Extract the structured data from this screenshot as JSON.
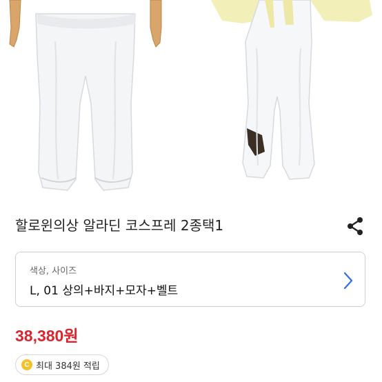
{
  "product": {
    "title": "할로윈의상 알라딘 코스프레 2종택1"
  },
  "option": {
    "label": "색상, 사이즈",
    "value": "L, 01 상의+바지+모자+벨트"
  },
  "price": {
    "amount": "38,380원"
  },
  "points": {
    "coin_symbol": "C",
    "text": "최대 384원 적립"
  },
  "colors": {
    "price": "#d8262e",
    "coin": "#f3c12b",
    "chevron": "#2d6fe0"
  },
  "icons": {
    "share": "share-icon",
    "chevron": "chevron-right-icon",
    "coin": "coin-icon"
  }
}
